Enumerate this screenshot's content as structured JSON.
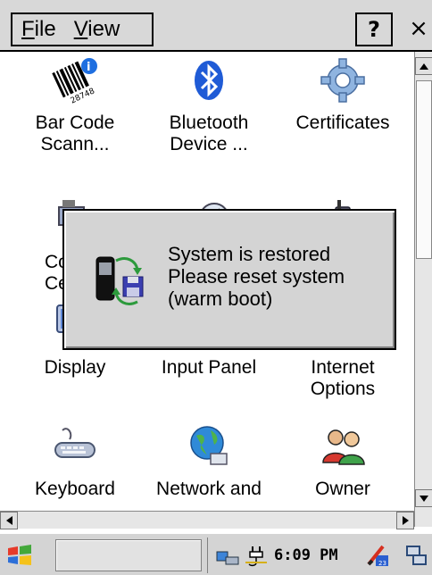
{
  "menubar": {
    "file_label": "File",
    "file_mnemonic": "F",
    "file_rest": "ile",
    "view_label": "View",
    "view_mnemonic": "V",
    "view_rest": "iew",
    "help_label": "?",
    "close_label": "×"
  },
  "items": [
    {
      "label": "Bar Code\nScann...",
      "icon": "barcode-icon"
    },
    {
      "label": "Bluetooth\nDevice ...",
      "icon": "bluetooth-icon"
    },
    {
      "label": "Certificates",
      "icon": "certificates-icon"
    },
    {
      "label": "Co\nCe",
      "icon": "computer-icon"
    },
    {
      "label": "",
      "icon": "clock-icon"
    },
    {
      "label": "",
      "icon": "phone-icon"
    },
    {
      "label": "Display",
      "icon": "display-icon"
    },
    {
      "label": "Input Panel",
      "icon": "input-panel-icon"
    },
    {
      "label": "Internet\nOptions",
      "icon": "internet-options-icon"
    },
    {
      "label": "Keyboard",
      "icon": "keyboard-icon"
    },
    {
      "label": "Network and",
      "icon": "network-icon"
    },
    {
      "label": "Owner",
      "icon": "owner-icon"
    }
  ],
  "dialog": {
    "line1": "System is restored",
    "line2": "Please reset system",
    "line3": "(warm boot)",
    "icon": "restore-device-icon"
  },
  "taskbar": {
    "clock": "6:09 PM",
    "start_icon": "windows-flag-icon",
    "tray_icons": [
      "network-tray-icon",
      "power-plug-icon",
      "input-method-icon",
      "connection-icon"
    ]
  },
  "colors": {
    "bar_gray": "#d8d8d8",
    "dialog_gray": "#d4d4d4",
    "accent_blue": "#1f5bd6"
  }
}
